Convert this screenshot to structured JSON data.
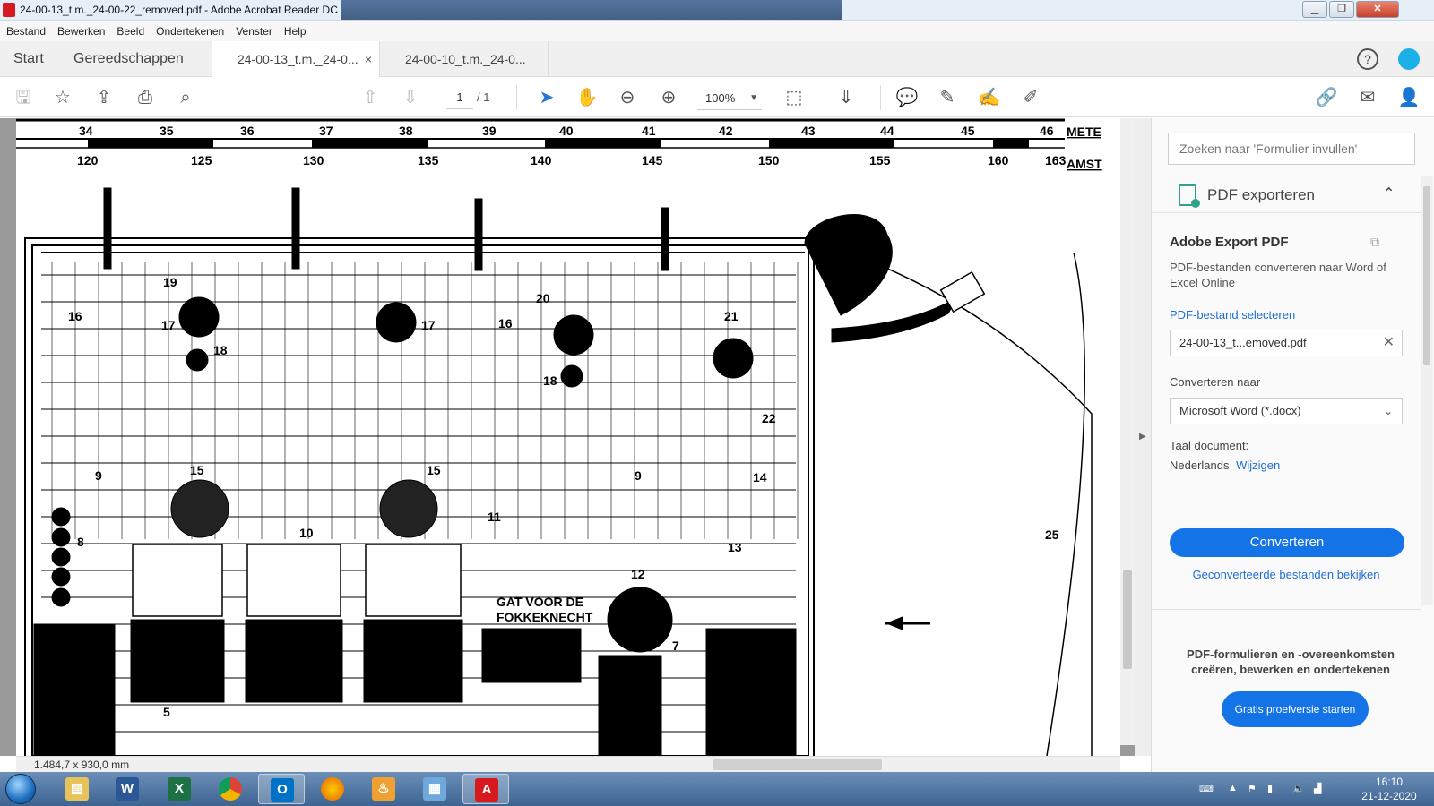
{
  "window": {
    "title": "24-00-13_t.m._24-00-22_removed.pdf - Adobe Acrobat Reader DC",
    "controls": {
      "minimize": "▁",
      "maximize": "❐",
      "close": "✕"
    }
  },
  "menu": [
    "Bestand",
    "Bewerken",
    "Beeld",
    "Ondertekenen",
    "Venster",
    "Help"
  ],
  "tabs": {
    "home": "Start",
    "tools": "Gereedschappen",
    "documents": [
      {
        "label": "24-00-13_t.m._24-0...",
        "active": true,
        "close": "×"
      },
      {
        "label": "24-00-10_t.m._24-0...",
        "active": false
      }
    ]
  },
  "toolbar": {
    "page_current": "1",
    "page_total": "/ 1",
    "zoom": "100%",
    "icons": [
      "save-icon",
      "star-icon",
      "upload-icon",
      "print-icon",
      "zoom-search-icon",
      "page-up-icon",
      "page-down-icon",
      "select-arrow-icon",
      "hand-icon",
      "zoom-out-icon",
      "zoom-in-icon",
      "fit-page-icon",
      "scroll-mode-icon",
      "comment-icon",
      "highlight-icon",
      "sign-icon",
      "fill-sign-icon",
      "share-link-icon",
      "email-icon",
      "add-user-icon",
      "help-icon",
      "account-icon"
    ]
  },
  "document": {
    "page_size": "1.484,7 x 930,0 mm",
    "scale_top": [
      "34",
      "35",
      "36",
      "37",
      "38",
      "39",
      "40",
      "41",
      "42",
      "43",
      "44",
      "45",
      "46"
    ],
    "scale_top_label": "METE",
    "scale_bottom": [
      "120",
      "125",
      "130",
      "135",
      "140",
      "145",
      "150",
      "155",
      "160",
      "163"
    ],
    "scale_bottom_label": "AMST",
    "callouts": [
      "19",
      "16",
      "17",
      "18",
      "17",
      "16",
      "20",
      "21",
      "18",
      "22",
      "9",
      "15",
      "15",
      "9",
      "14",
      "8",
      "10",
      "11",
      "13",
      "12",
      "5",
      "7",
      "25"
    ],
    "drawing_note_line1": "GAT VOOR DE",
    "drawing_note_line2": "FOKKEKNECHT"
  },
  "tool_pane": {
    "search_placeholder": "Zoeken naar 'Formulier invullen'",
    "section_title": "PDF exporteren",
    "service_title": "Adobe Export PDF",
    "service_desc": "PDF-bestanden converteren naar Word of Excel Online",
    "select_file_link": "PDF-bestand selecteren",
    "selected_file": "24-00-13_t...emoved.pdf",
    "convert_to_label": "Converteren naar",
    "convert_to_value": "Microsoft Word (*.docx)",
    "language_label": "Taal document:",
    "language_value": "Nederlands",
    "language_change": "Wijzigen",
    "convert_button": "Converteren",
    "view_converted": "Geconverteerde bestanden bekijken",
    "promo_text": "PDF-formulieren en -overeenkomsten creëren, bewerken en ondertekenen",
    "trial_button": "Gratis proefversie starten"
  },
  "taskbar": {
    "apps": [
      "explorer-icon",
      "word-icon",
      "excel-icon",
      "chrome-icon",
      "outlook-icon",
      "firefox-icon",
      "flame-app-icon",
      "photos-icon",
      "acrobat-icon"
    ],
    "time": "16:10",
    "date": "21-12-2020"
  },
  "colors": {
    "accent": "#1473e6",
    "acrobat_red": "#d71920",
    "export_green": "#2ea38a"
  }
}
